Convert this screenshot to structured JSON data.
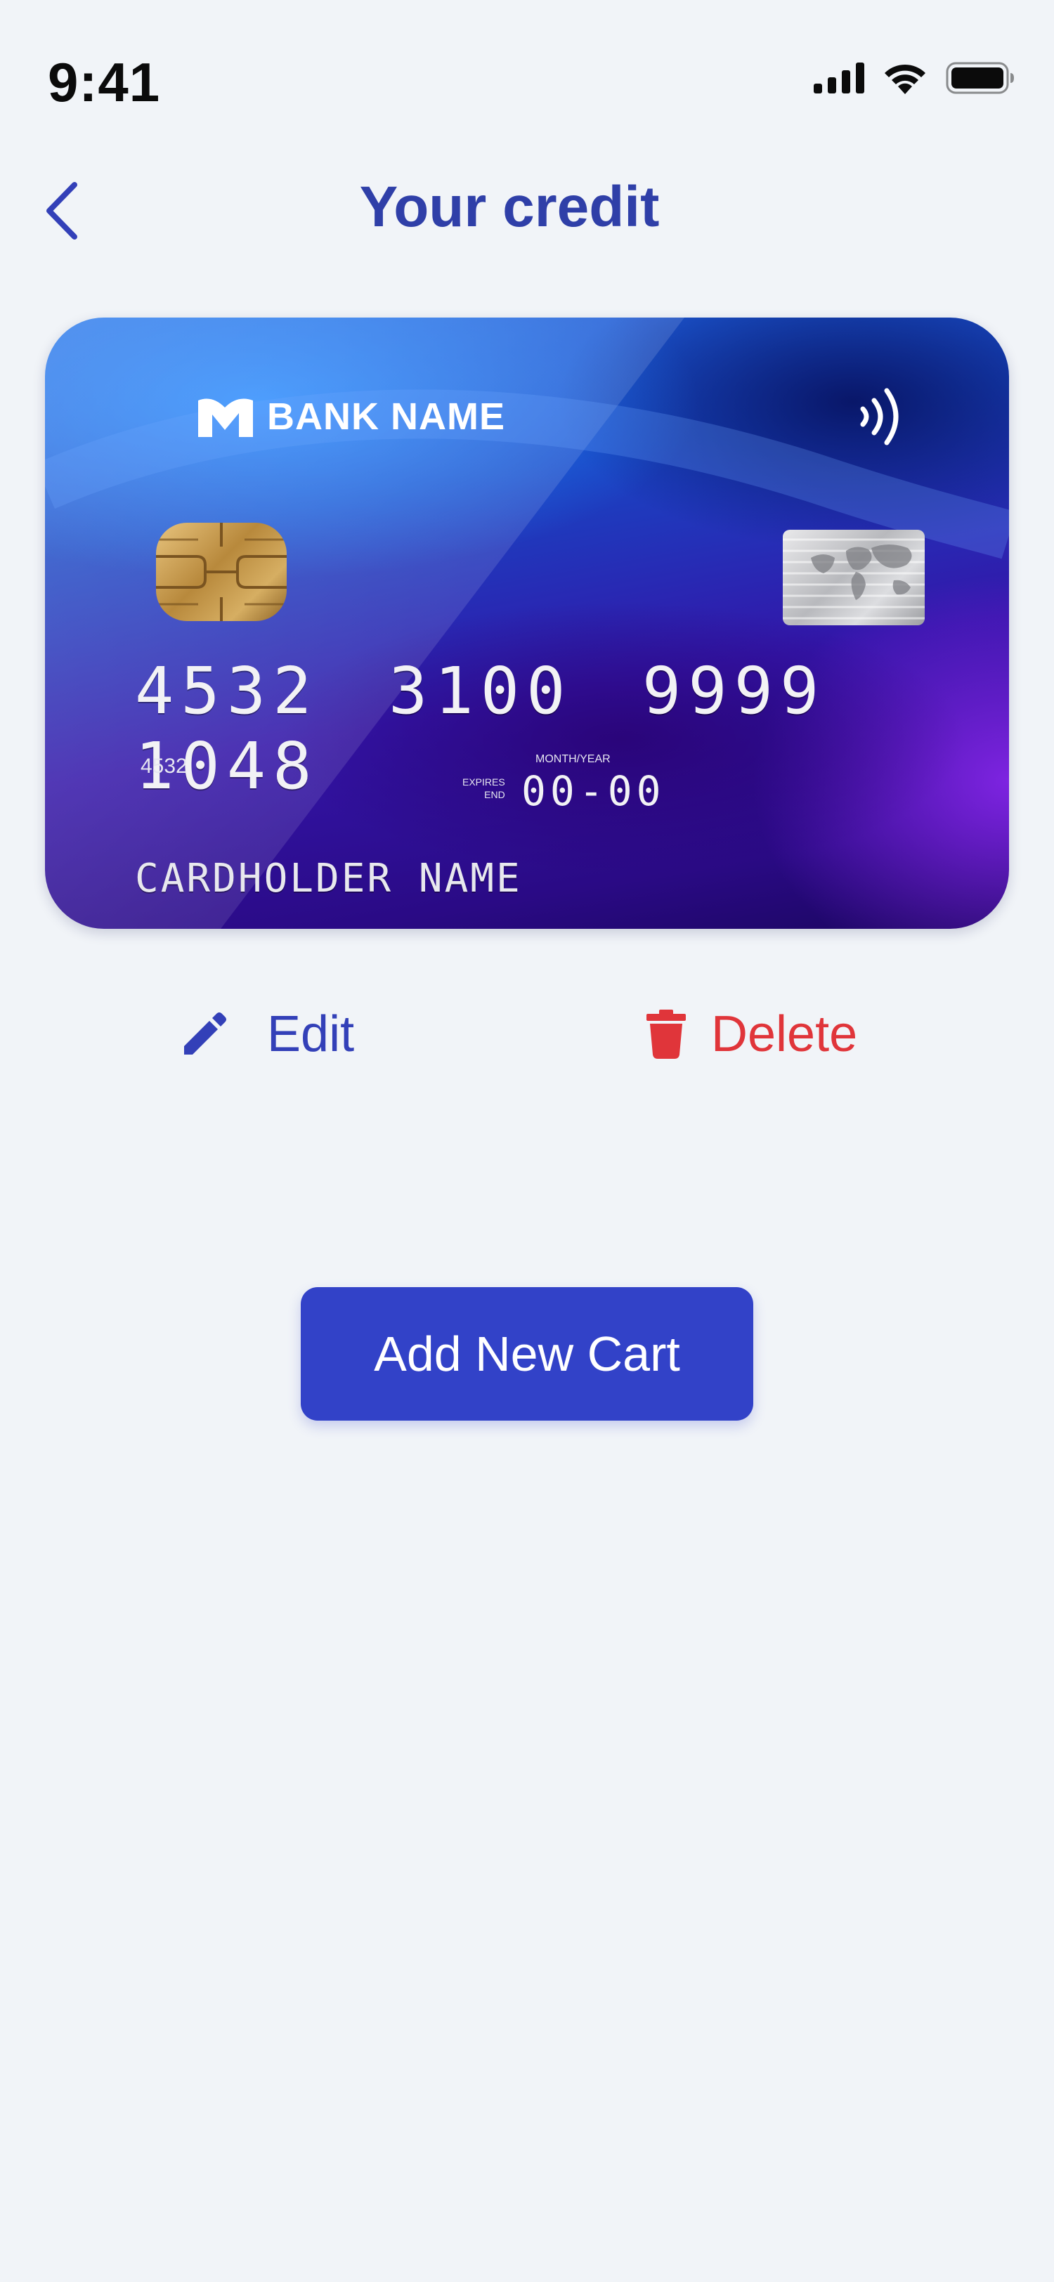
{
  "status_bar": {
    "time": "9:41",
    "icons": [
      "cellular-signal-icon",
      "wifi-icon",
      "battery-icon"
    ]
  },
  "header": {
    "back_icon": "chevron-left-icon",
    "title": "Your credit"
  },
  "card": {
    "bank_name": "BANK NAME",
    "number": "4532 3100 9999 1048",
    "number_short": "4532",
    "expires_label": "EXPIRES\nEND",
    "month_year_label": "MONTH/YEAR",
    "expiry": "00-00",
    "cardholder": "CARDHOLDER NAME",
    "icons": [
      "bank-logo-icon",
      "contactless-icon",
      "chip-icon",
      "hologram-icon"
    ]
  },
  "actions": {
    "edit_label": "Edit",
    "edit_icon": "pencil-icon",
    "delete_label": "Delete",
    "delete_icon": "trash-icon"
  },
  "add_button_label": "Add New Cart",
  "colors": {
    "background": "#F1F4F8",
    "primary": "#3242C8",
    "title": "#2F3FA8",
    "danger": "#E0353A"
  }
}
